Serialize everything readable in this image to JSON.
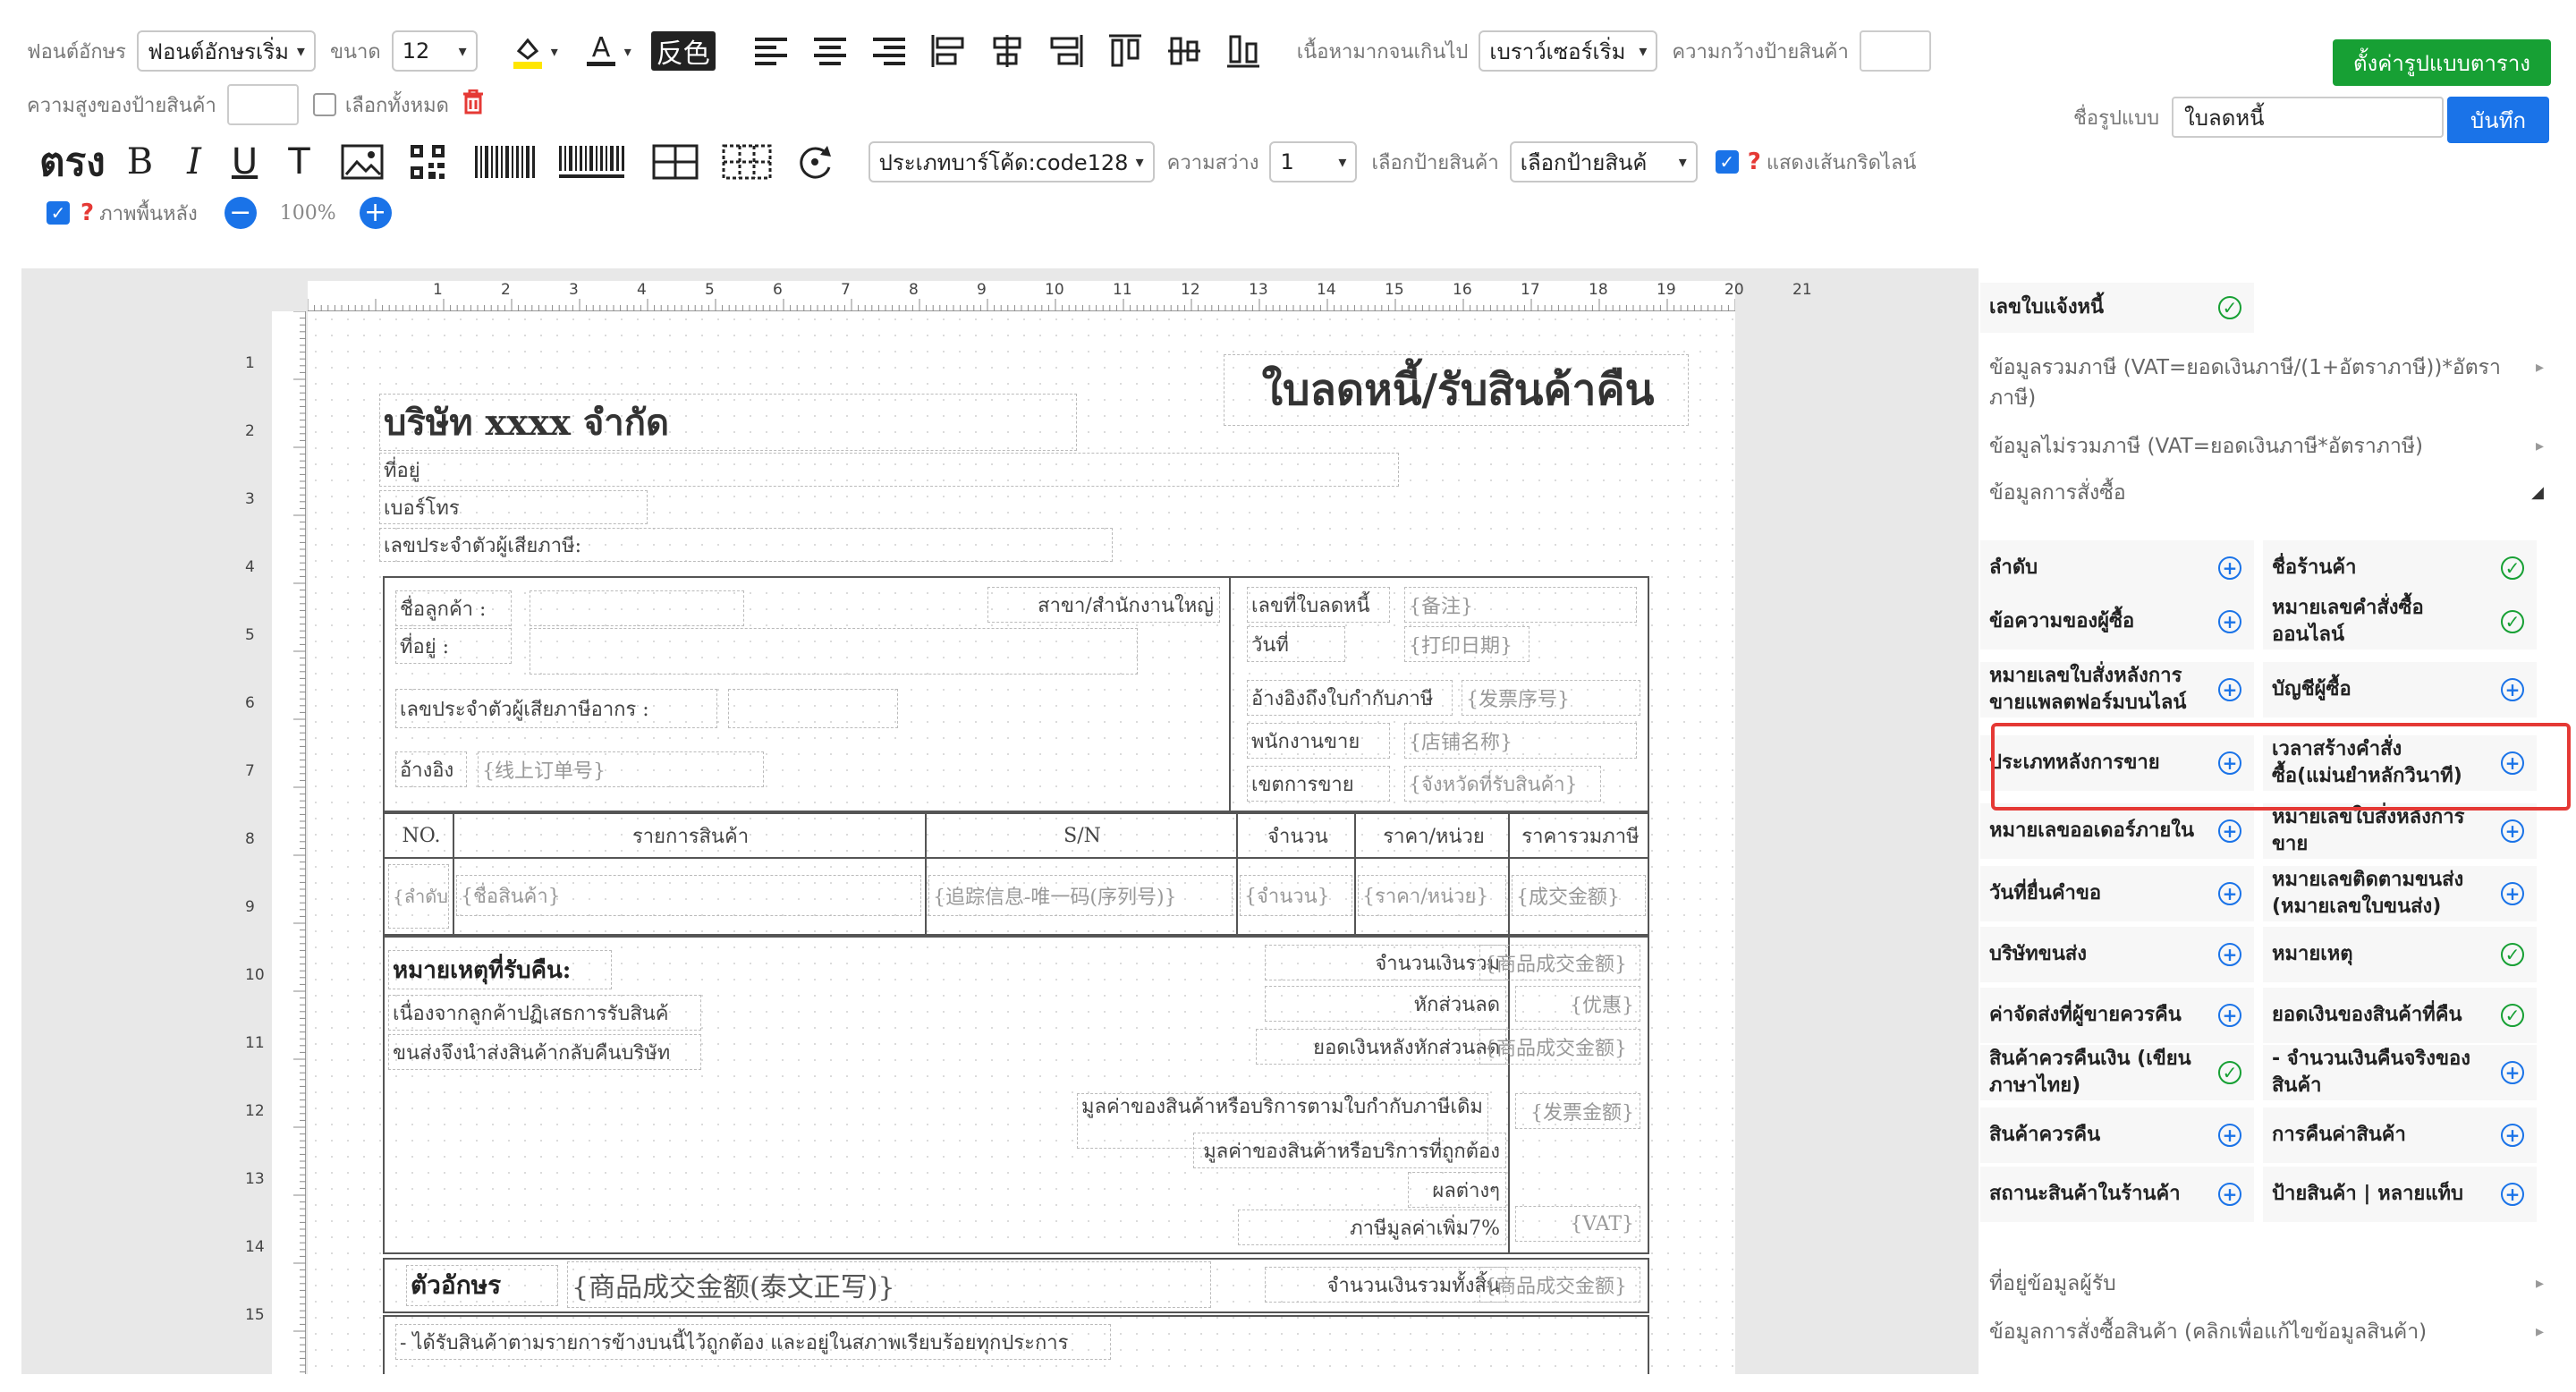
{
  "toolbar": {
    "font_label": "ฟอนต์อักษร",
    "font_value": "ฟอนต์อักษรเริ่ม",
    "size_label": "ขนาด",
    "size_value": "12",
    "invert_label": "反色",
    "overflow_label": "เนื้อหามากจนเกินไป",
    "overflow_value": "เบราว์เซอร์เริ่ม",
    "width_label": "ความกว้างป้ายสินค้า",
    "height_label": "ความสูงของป้ายสินค้า",
    "select_all_label": "เลือกทั้งหมด",
    "bold_label": "ตรง",
    "barcode_label": "ประเภทบาร์โค้ด:code128",
    "brightness_label": "ความสว่าง",
    "brightness_value": "1",
    "choose_label_label": "เลือกป้ายสินค้า",
    "choose_label_value": "เลือกป้ายสินค้",
    "gridline_label": "แสดงเส้นกริดไลน์",
    "background_label": "ภาพพื้นหลัง",
    "zoom_value": "100%",
    "table_setting_button": "ตั้งค่ารูปแบบตาราง",
    "template_name_label": "ชื่อรูปแบบ",
    "template_name_value": "ใบลดหนี้",
    "save_button": "บันทึก"
  },
  "ruler": {
    "top": [
      "1",
      "2",
      "3",
      "4",
      "5",
      "6",
      "7",
      "8",
      "9",
      "10",
      "11",
      "12",
      "13",
      "14",
      "15",
      "16",
      "17",
      "18",
      "19",
      "20",
      "21"
    ],
    "left": [
      "1",
      "2",
      "3",
      "4",
      "5",
      "6",
      "7",
      "8",
      "9",
      "10",
      "11",
      "12",
      "13",
      "14",
      "15"
    ]
  },
  "doc": {
    "title": "ใบลดหนี้/รับสินค้าคืน",
    "company": "บริษัท xxxx จำกัด",
    "address": "ที่อยู่",
    "phone": "เบอร์โทร",
    "taxid": "เลขประจำตัวผู้เสียภาษี:",
    "customer_name": "ชื่อลูกค้า :",
    "branch": "สาขา/สำนักงานใหญ่",
    "cust_address": "ที่อยู่ :",
    "cust_taxid": "เลขประจำตัวผู้เสียภาษีอากร :",
    "ref": "อ้างอิง",
    "ref_ph": "{线上订单号}",
    "credit_no": "เลขที่ใบลดหนี้",
    "credit_no_ph": "{备注}",
    "date": "วันที่",
    "date_ph": "{打印日期}",
    "invoice_ref": "อ้างอิงถึงใบกำกับภาษี",
    "invoice_ref_ph": "{发票序号}",
    "salesman": "พนักงานขาย",
    "salesman_ph": "{店铺名称}",
    "sales_area": "เขตการขาย",
    "sales_area_ph": "{จังหวัดที่รับสินค้า}",
    "col_no": "NO.",
    "col_item": "รายการสินค้า",
    "col_sn": "S/N",
    "col_qty": "จำนวน",
    "col_price": "ราคา/หน่วย",
    "col_total": "ราคารวมภาษี",
    "cell_no": "{ลำดับ}",
    "cell_item": "{ชื่อสินค้า}",
    "cell_sn": "{追踪信息-唯一码(序列号)}",
    "cell_qty": "{จำนวน}",
    "cell_price": "{ราคา/หน่วย}",
    "cell_total": "{成交金额}",
    "remark_title": "หมายเหตุที่รับคืน:",
    "remark_1": "เนื่องจากลูกค้าปฏิเสธการรับสินค้",
    "remark_2": "ขนส่งจึงนำส่งสินค้ากลับคืนบริษัท",
    "sum_label": "จำนวนเงินรวม",
    "sum_ph": "{商品成交金额}",
    "discount_label": "หักส่วนลด",
    "discount_ph": "{优惠}",
    "after_discount_label": "ยอดเงินหลังหักส่วนลด",
    "after_discount_ph": "{商品成交金额}",
    "orig_value_label": "มูลค่าของสินค้าหรือบริการตามใบกำกับภาษีเดิม",
    "orig_value_ph": "{发票金额}",
    "correct_value_label": "มูลค่าของสินค้าหรือบริการที่ถูกต้อง",
    "diff_label": "ผลต่างๆ",
    "vat_label": "ภาษีมูลค่าเพิ่ม7%",
    "vat_ph": "{VAT}",
    "letters_label": "ตัวอักษร",
    "letters_ph": "{商品成交金额(泰文正写)}",
    "grand_total_label": "จำนวนเงินรวมทั้งสิ้น",
    "grand_total_ph": "{商品成交金额}",
    "footer_note": "- ได้รับสินค้าตามรายการข้างบนนี้ไว้ถูกต้อง และอยู่ในสภาพเรียบร้อยทุกประการ"
  },
  "panel": {
    "top_item": "เลขใบแจ้งหนี้",
    "sections": {
      "vat_incl": "ข้อมูลรวมภาษี (VAT=ยอดเงินภาษี/(1+อัตราภาษี))*อัตราภาษี)",
      "vat_excl": "ข้อมูลไม่รวมภาษี (VAT=ยอดเงินภาษี*อัตราภาษี)",
      "order_info": "ข้อมูลการสั่งซื้อ",
      "buyer_address": "ที่อยู่ข้อมูลผู้รับ",
      "order_goods": "ข้อมูลการสั่งซื้อสินค้า (คลิกเพื่อแก้ไขข้อมูลสินค้า)"
    },
    "items": [
      {
        "label": "ลำดับ",
        "state": "plus"
      },
      {
        "label": "ชื่อร้านค้า",
        "state": "ok"
      },
      {
        "label": "ข้อความของผู้ซื้อ",
        "state": "plus"
      },
      {
        "label": "หมายเลขคำสั่งซื้อออนไลน์",
        "state": "ok"
      },
      {
        "label": "หมายเลขใบสั่งหลังการขายแพลตฟอร์มบนไลน์",
        "state": "plus"
      },
      {
        "label": "บัญชีผู้ซื้อ",
        "state": "plus"
      },
      {
        "label": "ประเภทหลังการขาย",
        "state": "plus"
      },
      {
        "label": "เวลาสร้างคำสั่งซื้อ(แม่นยำหลักวินาที)",
        "state": "plus"
      },
      {
        "label": "หมายเลขออเดอร์ภายใน",
        "state": "plus"
      },
      {
        "label": "หมายเลขใบสั่งหลังการขาย",
        "state": "plus"
      },
      {
        "label": "วันที่ยื่นคำขอ",
        "state": "plus"
      },
      {
        "label": "หมายเลขติดตามขนส่ง (หมายเลขใบขนส่ง)",
        "state": "plus"
      },
      {
        "label": "บริษัทขนส่ง",
        "state": "plus"
      },
      {
        "label": "หมายเหตุ",
        "state": "ok"
      },
      {
        "label": "ค่าจัดส่งที่ผู้ขายควรคืน",
        "state": "plus"
      },
      {
        "label": "ยอดเงินของสินค้าที่คืน",
        "state": "ok"
      },
      {
        "label": "สินค้าควรคืนเงิน (เขียนภาษาไทย)",
        "state": "ok"
      },
      {
        "label": "- จำนวนเงินคืนจริงของสินค้า",
        "state": "plus"
      },
      {
        "label": "สินค้าควรคืน",
        "state": "plus"
      },
      {
        "label": "การคืนค่าสินค้า",
        "state": "plus"
      },
      {
        "label": "สถานะสินค้าในร้านค้า",
        "state": "plus"
      },
      {
        "label": "ป้ายสินค้า | หลายแท็บ",
        "state": "plus"
      }
    ]
  },
  "colors": {
    "accent": "#1a73e8",
    "green": "#17a034",
    "highlight": "#e53935"
  }
}
